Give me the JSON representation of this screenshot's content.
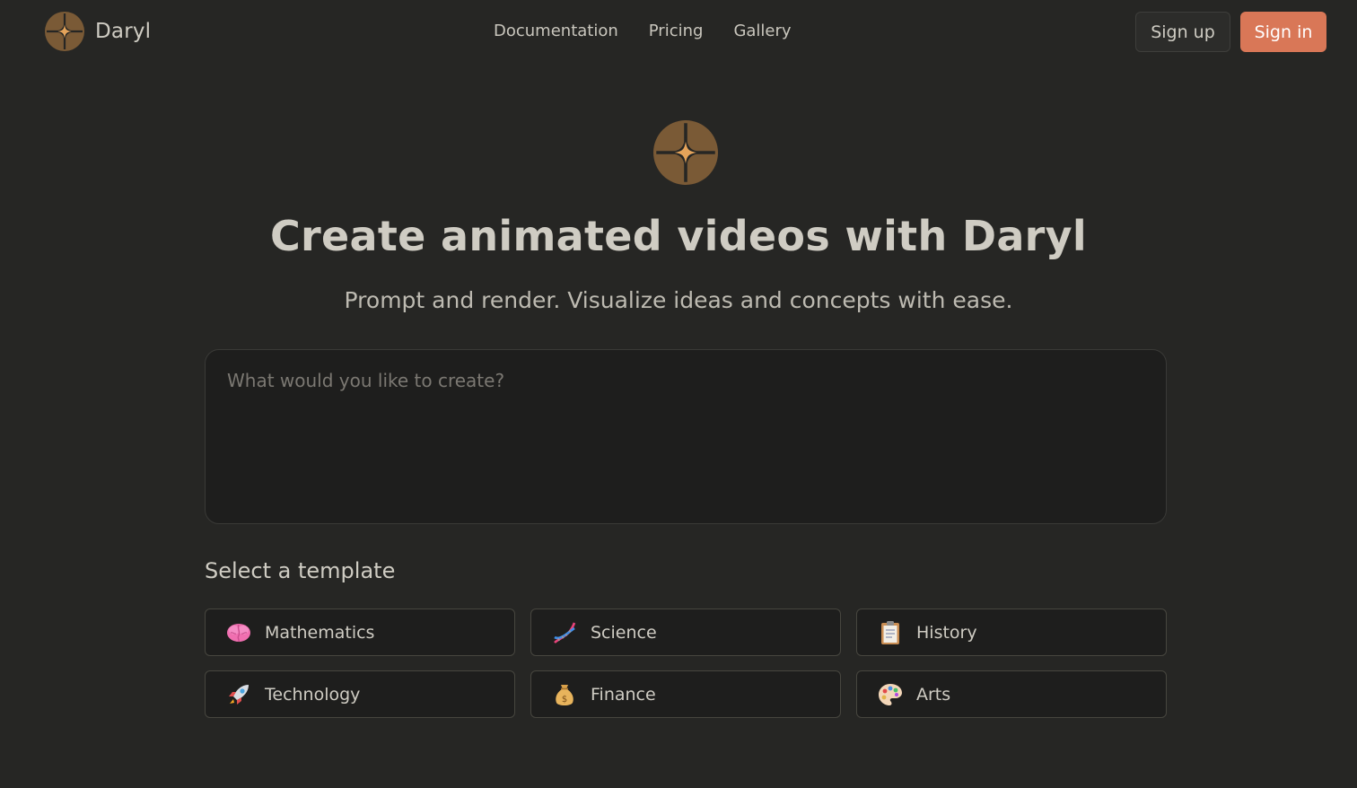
{
  "header": {
    "brand_name": "Daryl",
    "nav": [
      "Documentation",
      "Pricing",
      "Gallery"
    ],
    "signup_label": "Sign up",
    "signin_label": "Sign in"
  },
  "hero": {
    "title": "Create animated videos with Daryl",
    "subtitle": "Prompt and render. Visualize ideas and concepts with ease."
  },
  "prompt": {
    "placeholder": "What would you like to create?",
    "value": ""
  },
  "templates": {
    "title": "Select a template",
    "items": [
      {
        "label": "Mathematics",
        "icon": "brain-icon"
      },
      {
        "label": "Science",
        "icon": "dna-icon"
      },
      {
        "label": "History",
        "icon": "clipboard-icon"
      },
      {
        "label": "Technology",
        "icon": "rocket-icon"
      },
      {
        "label": "Finance",
        "icon": "money-bag-icon"
      },
      {
        "label": "Arts",
        "icon": "palette-icon"
      }
    ]
  },
  "colors": {
    "background": "#262624",
    "accent": "#d97757",
    "logo": "#7a5a36",
    "logo_star": "#e4a35a"
  }
}
